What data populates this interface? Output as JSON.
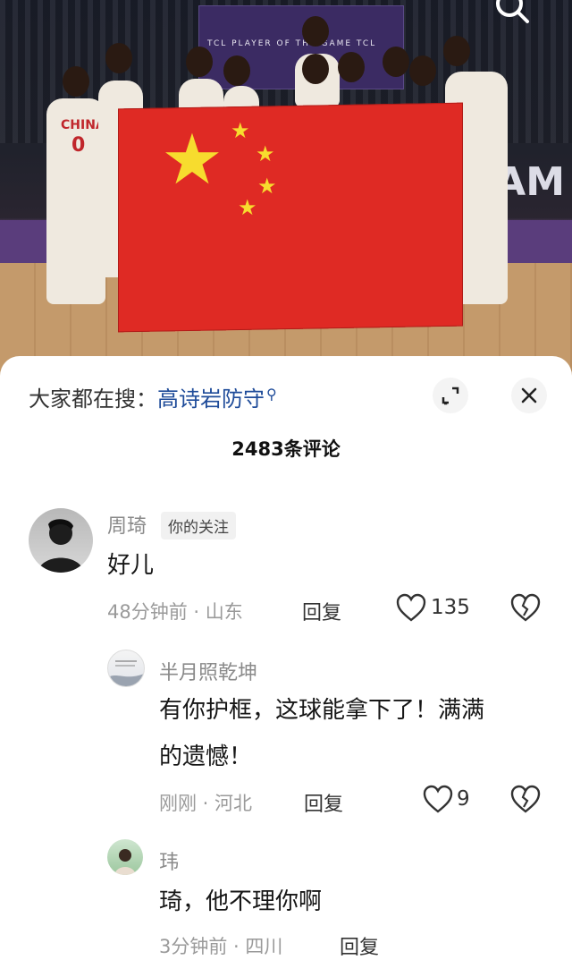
{
  "photo": {
    "board_text": "TCL  PLAYER OF THE GAME  TCL",
    "court_text": "GAM",
    "jersey_text": "CHINA",
    "jersey_number": "0"
  },
  "trending": {
    "label": "大家都在搜：",
    "term": "高诗岩防守"
  },
  "comments_header": {
    "count_text": "2483条评论"
  },
  "comments": [
    {
      "author": "周琦",
      "tag": "你的关注",
      "text": "好儿",
      "time": "48分钟前 · 山东",
      "reply_label": "回复",
      "likes": "135"
    }
  ],
  "replies": [
    {
      "author": "半月照乾坤",
      "text_line1": "有你护框，这球能拿下了！满满",
      "text_line2": "的遗憾！",
      "time": "刚刚 · 河北",
      "reply_label": "回复",
      "likes": "9"
    },
    {
      "author": "玮",
      "text": "琦，他不理你啊",
      "time": "3分钟前 · 四川",
      "reply_label": "回复"
    }
  ],
  "colors": {
    "accent_blue": "#1e4b99",
    "flag_red": "#df2a24",
    "star_yellow": "#f7dc2e"
  }
}
